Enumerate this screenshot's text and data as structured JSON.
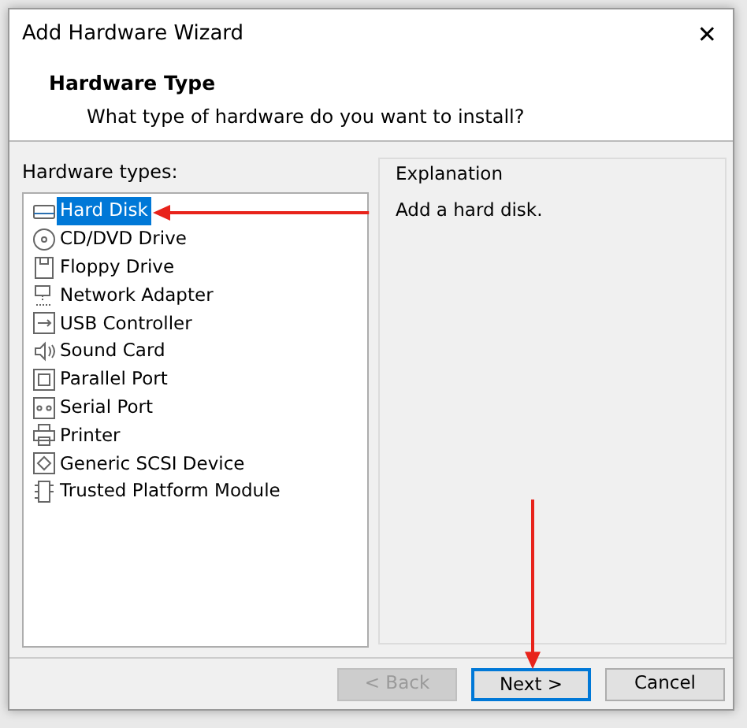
{
  "window": {
    "title": "Add Hardware Wizard",
    "close": "✕"
  },
  "header": {
    "title": "Hardware Type",
    "subtitle": "What type of hardware do you want to install?"
  },
  "hardware_types": {
    "label": "Hardware types:",
    "items": [
      {
        "label": "Hard Disk",
        "kind": "disk",
        "selected": true
      },
      {
        "label": "CD/DVD Drive",
        "kind": "cd",
        "selected": false
      },
      {
        "label": "Floppy Drive",
        "kind": "floppy",
        "selected": false
      },
      {
        "label": "Network Adapter",
        "kind": "network",
        "selected": false
      },
      {
        "label": "USB Controller",
        "kind": "usb",
        "selected": false
      },
      {
        "label": "Sound Card",
        "kind": "sound",
        "selected": false
      },
      {
        "label": "Parallel Port",
        "kind": "parallel",
        "selected": false
      },
      {
        "label": "Serial Port",
        "kind": "serial",
        "selected": false
      },
      {
        "label": "Printer",
        "kind": "printer",
        "selected": false
      },
      {
        "label": "Generic SCSI Device",
        "kind": "scsi",
        "selected": false
      },
      {
        "label": "Trusted Platform Module",
        "kind": "tpm",
        "selected": false
      }
    ]
  },
  "explanation": {
    "label": "Explanation",
    "text": "Add a hard disk."
  },
  "buttons": [
    {
      "label": "< Back",
      "disabled": true,
      "default": false
    },
    {
      "label": "Next >",
      "disabled": false,
      "default": true
    },
    {
      "label": "Cancel",
      "disabled": false,
      "default": false
    }
  ]
}
